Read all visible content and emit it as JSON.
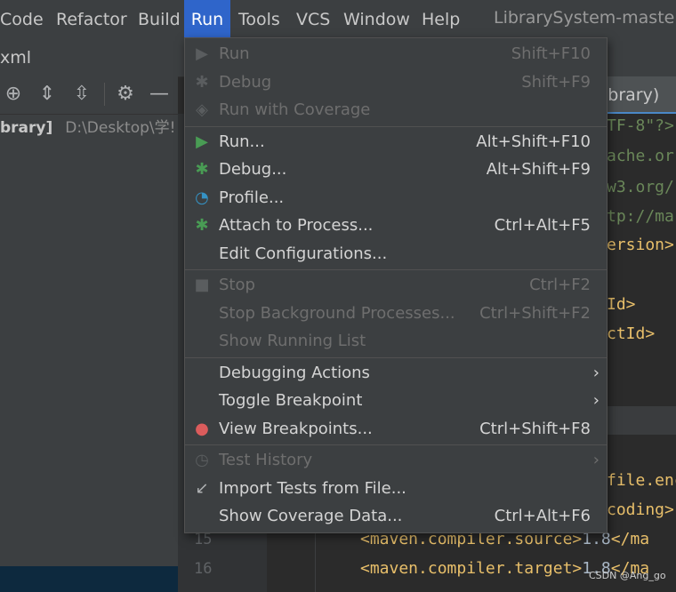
{
  "menubar": {
    "items": [
      "Code",
      "Refactor",
      "Build",
      "Run",
      "Tools",
      "VCS",
      "Window",
      "Help"
    ],
    "active": "Run",
    "title": "LibrarySystem-master - "
  },
  "project_tab": "xml",
  "tree": {
    "name": "brary]",
    "path": "D:\\Desktop\\学!"
  },
  "editor": {
    "tab_label": "ibrary)",
    "lines": [
      {
        "text": "TF-8\"?>",
        "kind": "str"
      },
      {
        "text": "ache.or",
        "kind": "str"
      },
      {
        "text": "w3.org/",
        "kind": "str"
      },
      {
        "text": "tp://ma",
        "kind": "str"
      },
      {
        "text": "ersion>",
        "kind": "tag"
      },
      {
        "text": "",
        "kind": "plain"
      },
      {
        "text": "Id>",
        "kind": "tag"
      },
      {
        "text": "ctId>",
        "kind": "tag"
      },
      {
        "text": "",
        "kind": "plain"
      },
      {
        "text": "",
        "kind": "plain"
      },
      {
        "text": "",
        "kind": "plain"
      },
      {
        "text": "file.enc",
        "kind": "tag"
      },
      {
        "text": "coding>",
        "kind": "tag"
      }
    ],
    "line15": {
      "num": "15",
      "tag": "<maven.compiler.source>",
      "val": "1.8",
      "close": "</ma"
    },
    "line16": {
      "num": "16",
      "tag": "<maven.compiler.target>",
      "val": "1.8",
      "close": "</ma"
    }
  },
  "run_menu": [
    {
      "icon": "run-icon",
      "label": "Run",
      "shortcut": "Shift+F10",
      "disabled": true
    },
    {
      "icon": "debug-icon",
      "label": "Debug",
      "shortcut": "Shift+F9",
      "disabled": true
    },
    {
      "icon": "coverage-icon",
      "label": "Run with Coverage",
      "shortcut": "",
      "disabled": true
    },
    {
      "sep": true
    },
    {
      "icon": "run-icon",
      "label": "Run...",
      "shortcut": "Alt+Shift+F10",
      "disabled": false
    },
    {
      "icon": "debug-icon",
      "label": "Debug...",
      "shortcut": "Alt+Shift+F9",
      "disabled": false
    },
    {
      "icon": "profile-icon",
      "label": "Profile...",
      "shortcut": "",
      "disabled": false
    },
    {
      "icon": "attach-icon",
      "label": "Attach to Process...",
      "shortcut": "Ctrl+Alt+F5",
      "disabled": false
    },
    {
      "icon": "",
      "label": "Edit Configurations...",
      "shortcut": "",
      "disabled": false
    },
    {
      "sep": true
    },
    {
      "icon": "stop-icon",
      "label": "Stop",
      "shortcut": "Ctrl+F2",
      "disabled": true
    },
    {
      "icon": "",
      "label": "Stop Background Processes...",
      "shortcut": "Ctrl+Shift+F2",
      "disabled": true
    },
    {
      "icon": "",
      "label": "Show Running List",
      "shortcut": "",
      "disabled": true
    },
    {
      "sep": true
    },
    {
      "icon": "",
      "label": "Debugging Actions",
      "shortcut": "",
      "disabled": false,
      "submenu": true
    },
    {
      "icon": "",
      "label": "Toggle Breakpoint",
      "shortcut": "",
      "disabled": false,
      "submenu": true
    },
    {
      "icon": "breakpoints-icon",
      "label": "View Breakpoints...",
      "shortcut": "Ctrl+Shift+F8",
      "disabled": false
    },
    {
      "sep": true
    },
    {
      "icon": "history-icon",
      "label": "Test History",
      "shortcut": "",
      "disabled": true,
      "submenu": true
    },
    {
      "icon": "import-icon",
      "label": "Import Tests from File...",
      "shortcut": "",
      "disabled": false
    },
    {
      "icon": "",
      "label": "Show Coverage Data...",
      "shortcut": "Ctrl+Alt+F6",
      "disabled": false
    }
  ],
  "watermark": "CSDN @Ang_go"
}
